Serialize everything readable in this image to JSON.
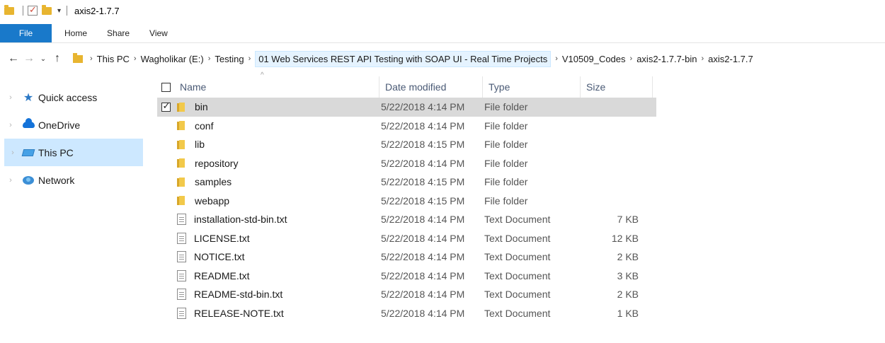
{
  "window": {
    "title": "axis2-1.7.7"
  },
  "ribbon": {
    "tabs": [
      "File",
      "Home",
      "Share",
      "View"
    ]
  },
  "address": {
    "crumbs": [
      "This PC",
      "Wagholikar (E:)",
      "Testing",
      "01 Web Services REST API Testing with SOAP UI - Real Time Projects",
      "V10509_Codes",
      "axis2-1.7.7-bin",
      "axis2-1.7.7"
    ]
  },
  "nav": {
    "items": [
      {
        "label": "Quick access",
        "icon": "star-icon"
      },
      {
        "label": "OneDrive",
        "icon": "cloud-icon"
      },
      {
        "label": "This PC",
        "icon": "computer-icon"
      },
      {
        "label": "Network",
        "icon": "network-icon"
      }
    ]
  },
  "columns": {
    "name": "Name",
    "date": "Date modified",
    "type": "Type",
    "size": "Size"
  },
  "files": [
    {
      "name": "bin",
      "date": "5/22/2018 4:14 PM",
      "type": "File folder",
      "size": "",
      "kind": "folder"
    },
    {
      "name": "conf",
      "date": "5/22/2018 4:14 PM",
      "type": "File folder",
      "size": "",
      "kind": "folder"
    },
    {
      "name": "lib",
      "date": "5/22/2018 4:15 PM",
      "type": "File folder",
      "size": "",
      "kind": "folder"
    },
    {
      "name": "repository",
      "date": "5/22/2018 4:14 PM",
      "type": "File folder",
      "size": "",
      "kind": "folder"
    },
    {
      "name": "samples",
      "date": "5/22/2018 4:15 PM",
      "type": "File folder",
      "size": "",
      "kind": "folder"
    },
    {
      "name": "webapp",
      "date": "5/22/2018 4:15 PM",
      "type": "File folder",
      "size": "",
      "kind": "folder"
    },
    {
      "name": "installation-std-bin.txt",
      "date": "5/22/2018 4:14 PM",
      "type": "Text Document",
      "size": "7 KB",
      "kind": "text"
    },
    {
      "name": "LICENSE.txt",
      "date": "5/22/2018 4:14 PM",
      "type": "Text Document",
      "size": "12 KB",
      "kind": "text"
    },
    {
      "name": "NOTICE.txt",
      "date": "5/22/2018 4:14 PM",
      "type": "Text Document",
      "size": "2 KB",
      "kind": "text"
    },
    {
      "name": "README.txt",
      "date": "5/22/2018 4:14 PM",
      "type": "Text Document",
      "size": "3 KB",
      "kind": "text"
    },
    {
      "name": "README-std-bin.txt",
      "date": "5/22/2018 4:14 PM",
      "type": "Text Document",
      "size": "2 KB",
      "kind": "text"
    },
    {
      "name": "RELEASE-NOTE.txt",
      "date": "5/22/2018 4:14 PM",
      "type": "Text Document",
      "size": "1 KB",
      "kind": "text"
    }
  ]
}
